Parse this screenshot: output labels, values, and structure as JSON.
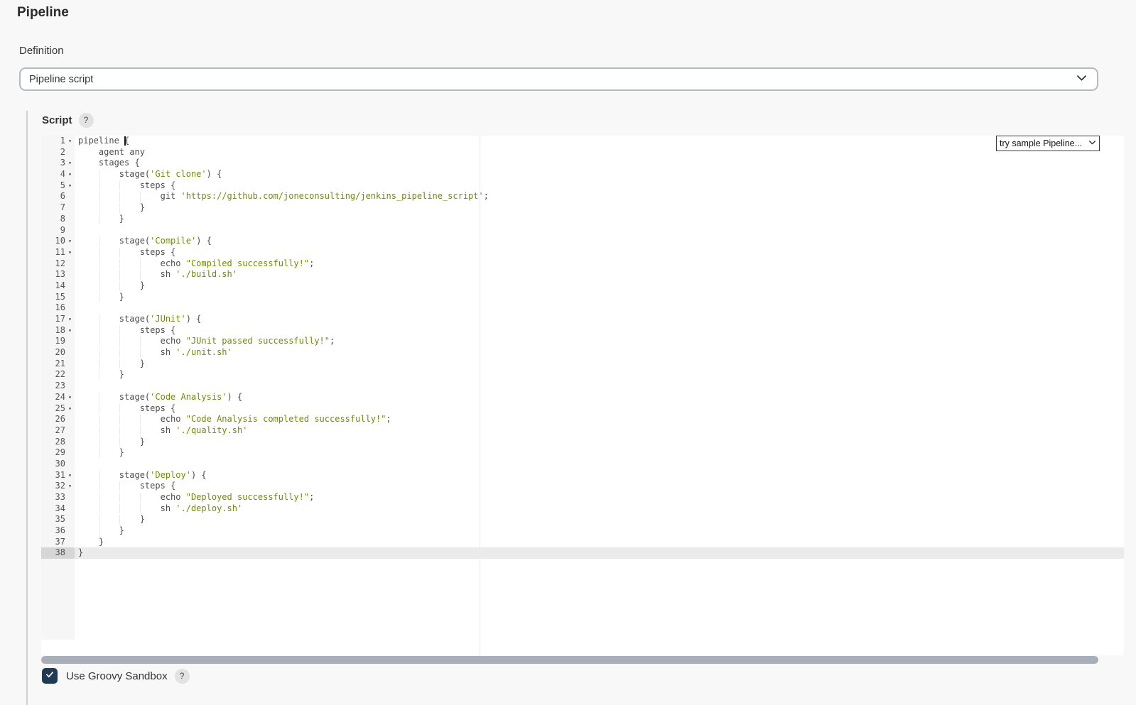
{
  "page": {
    "title": "Pipeline"
  },
  "definition": {
    "label": "Definition",
    "selected_option": "Pipeline script"
  },
  "script": {
    "label": "Script",
    "help_label": "?",
    "sample_select": {
      "selected_option": "try sample Pipeline..."
    },
    "editor": {
      "lines": [
        "pipeline {",
        "    agent any",
        "    stages {",
        "        stage('Git clone') {",
        "            steps {",
        "                git 'https://github.com/joneconsulting/jenkins_pipeline_script';",
        "            }",
        "        }",
        "",
        "        stage('Compile') {",
        "            steps {",
        "                echo \"Compiled successfully!\";",
        "                sh './build.sh'",
        "            }",
        "        }",
        "",
        "        stage('JUnit') {",
        "            steps {",
        "                echo \"JUnit passed successfully!\";",
        "                sh './unit.sh'",
        "            }",
        "        }",
        "",
        "        stage('Code Analysis') {",
        "            steps {",
        "                echo \"Code Analysis completed successfully!\";",
        "                sh './quality.sh'",
        "            }",
        "        }",
        "",
        "        stage('Deploy') {",
        "            steps {",
        "                echo \"Deployed successfully!\";",
        "                sh './deploy.sh'",
        "            }",
        "        }",
        "    }",
        "}"
      ],
      "fold_lines": [
        1,
        3,
        4,
        5,
        10,
        11,
        17,
        18,
        24,
        25,
        31,
        32
      ],
      "active_line": 38,
      "cursor": {
        "line": 1,
        "col": 9
      }
    }
  },
  "sandbox": {
    "label": "Use Groovy Sandbox",
    "checked": true,
    "help_label": "?"
  },
  "colors": {
    "string_token": "#718c00",
    "code_text": "#4d4d4c",
    "checkbox_checked": "#1e3a57",
    "active_line_bg": "#ebebeb",
    "gutter_bg": "#f6f6f6",
    "page_bg": "#f8f8f8"
  }
}
